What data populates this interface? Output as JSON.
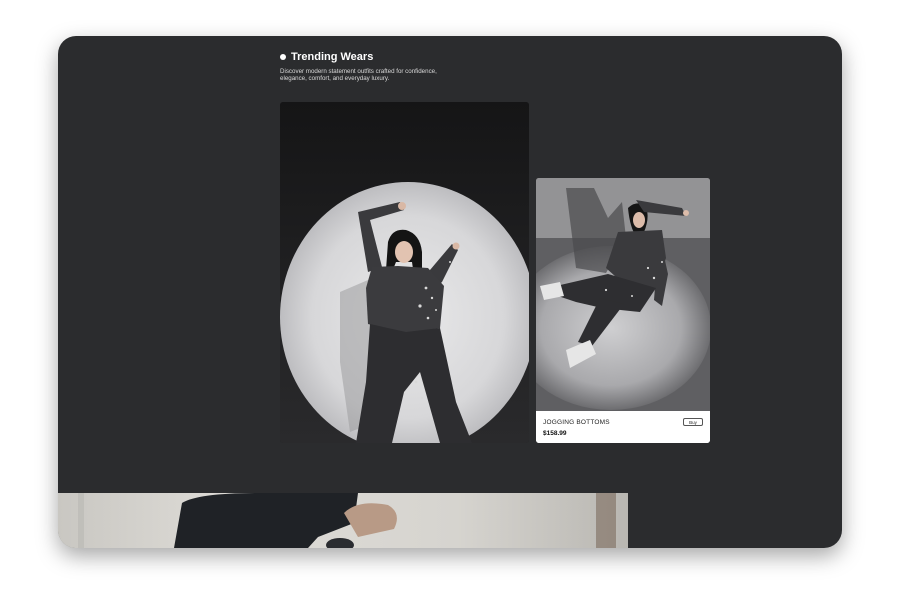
{
  "section": {
    "title": "Trending Wears",
    "description": "Discover modern statement outfits crafted for confidence, elegance, comfort, and everyday luxury."
  },
  "product": {
    "name": "JOGGING BOTTOMS",
    "price": "$158.99",
    "buy_label": "Buy"
  },
  "colors": {
    "page_background": "#2b2c2e",
    "card_background": "#ffffff",
    "text_primary": "#ffffff"
  },
  "icons": {
    "heading_bullet": "dot"
  }
}
